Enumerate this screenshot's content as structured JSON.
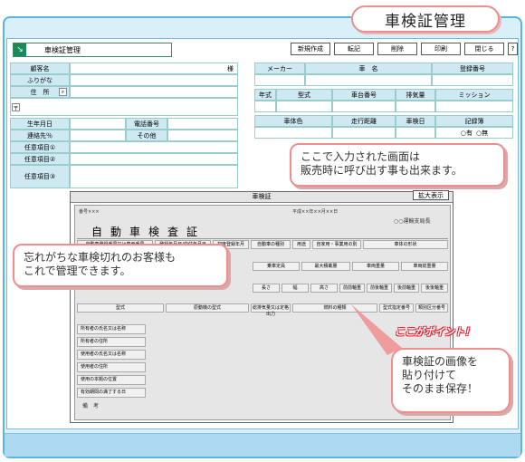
{
  "header": {
    "title": "車検証管理"
  },
  "app": {
    "title": "車検証管理",
    "toolbar": [
      "新規作成",
      "転記",
      "削除",
      "印刷",
      "閉じる",
      "?"
    ]
  },
  "left_form": {
    "rows": [
      {
        "label": "顧客名",
        "suffix": "様"
      },
      {
        "label": "ふりがな"
      },
      {
        "label": "住　所"
      },
      {
        "label": "〒"
      },
      {
        "label": "生年月日",
        "label2": "電話番号"
      },
      {
        "label": "連絡先％",
        "label2": "その他"
      },
      {
        "label": "任意項目①"
      },
      {
        "label": "任意項目②"
      },
      {
        "label": "任意項目③"
      }
    ]
  },
  "right_form": {
    "row1": [
      "メーカー",
      "車　名",
      "登録番号"
    ],
    "row2": [
      "年式",
      "型式",
      "車台番号",
      "排気量",
      "ミッション"
    ],
    "row3": [
      "車体色",
      "走行距離",
      "車検日",
      "記録簿"
    ],
    "radio": [
      "有",
      "無"
    ]
  },
  "callouts": {
    "input": "ここで入力された画面は\n販売時に呼び出す事も出来ます。",
    "customers": "忘れがちな車検切れのお客様も\nこれで管理できます。",
    "image": "車検証の画像を\n貼り付けて\nそのまま保存！",
    "point": "ここがポイント！"
  },
  "shaken": {
    "header": "車検証",
    "expand": "拡大表示",
    "doc_title": "自動車検査証",
    "doc_no": "番号×××",
    "doc_date": "平成××年××月××日",
    "office": "○○運輸支局長",
    "col_heads": [
      "自動車登録番号又は車両番号",
      "登録年月日/交付年月日",
      "初度登録年月",
      "自動車の種別",
      "用途",
      "自家用・事業用の別",
      "車体の形状"
    ],
    "mid_heads": [
      "乗車定員",
      "最大積載量",
      "車両重量",
      "車両総重量"
    ],
    "dim_heads": [
      "長さ",
      "幅",
      "高さ",
      "前前軸重",
      "前後軸重",
      "後前軸重",
      "後後軸重"
    ],
    "type_heads": [
      "型式",
      "原動機の型式",
      "総排気量又は定格出力",
      "燃料の種類",
      "型式指定番号",
      "類別区分番号"
    ],
    "owner_rows": [
      "所有者の氏名又は名称",
      "所有者の住所",
      "使用者の氏名又は名称",
      "使用者の住所",
      "使用の本拠の位置",
      "有効期間の満了する日"
    ],
    "remarks": "備　考"
  },
  "colors": {
    "frame_border": "#59b4e0",
    "callout_border": "#ee8e8e",
    "label_bg": "#cfe9f3"
  }
}
